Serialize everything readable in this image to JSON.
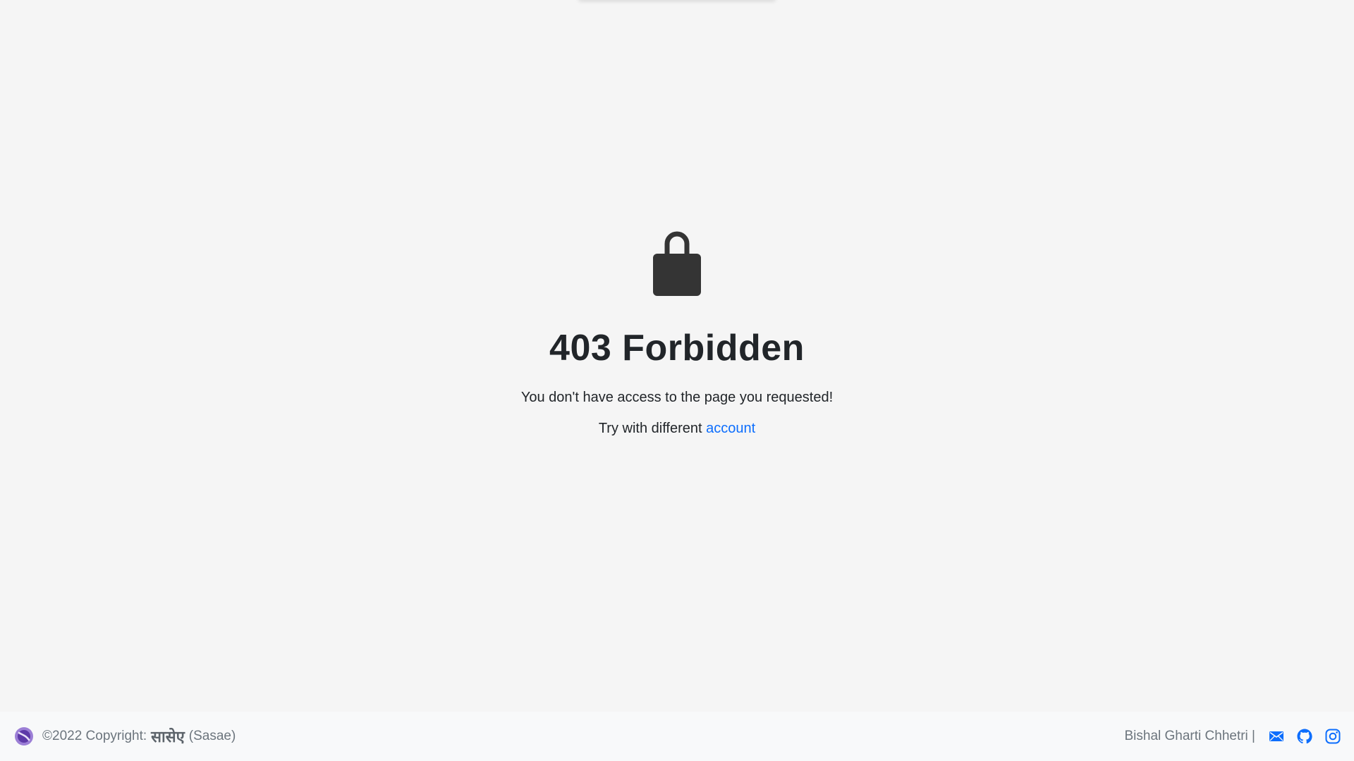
{
  "error": {
    "title": "403 Forbidden",
    "message": "You don't have access to the page you requested!",
    "retry_prefix": "Try with different",
    "retry_link": "account"
  },
  "footer": {
    "copyright_prefix": "©2022 Copyright:",
    "brand": "सासेए",
    "brand_latin": "(Sasae)",
    "author": "Bishal Gharti Chhetri |"
  },
  "icons": {
    "lock": "lock-icon",
    "logo": "sasae-logo",
    "email": "email-icon",
    "github": "github-icon",
    "instagram": "instagram-icon"
  },
  "colors": {
    "background": "#f5f5f5",
    "footer_bg": "#f8f9fa",
    "text": "#212529",
    "muted": "#6c757d",
    "link": "#0d6efd",
    "icon_dark": "#343434",
    "logo_purple": "#7e57c2"
  }
}
